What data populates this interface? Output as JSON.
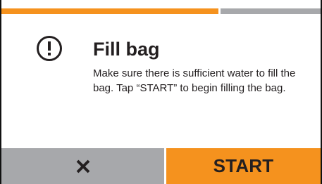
{
  "progress": {
    "fraction": 0.68,
    "color_fill": "#f5921e",
    "color_track": "#a7a8ab"
  },
  "dialog": {
    "icon": "alert-circle-icon",
    "title": "Fill bag",
    "message": "Make sure there is sufficient water to fill the bag. Tap “START” to begin filling the bag."
  },
  "buttons": {
    "cancel": {
      "icon": "close-icon",
      "color": "#a7a8ab"
    },
    "start": {
      "label": "START",
      "color": "#f5921e"
    }
  }
}
